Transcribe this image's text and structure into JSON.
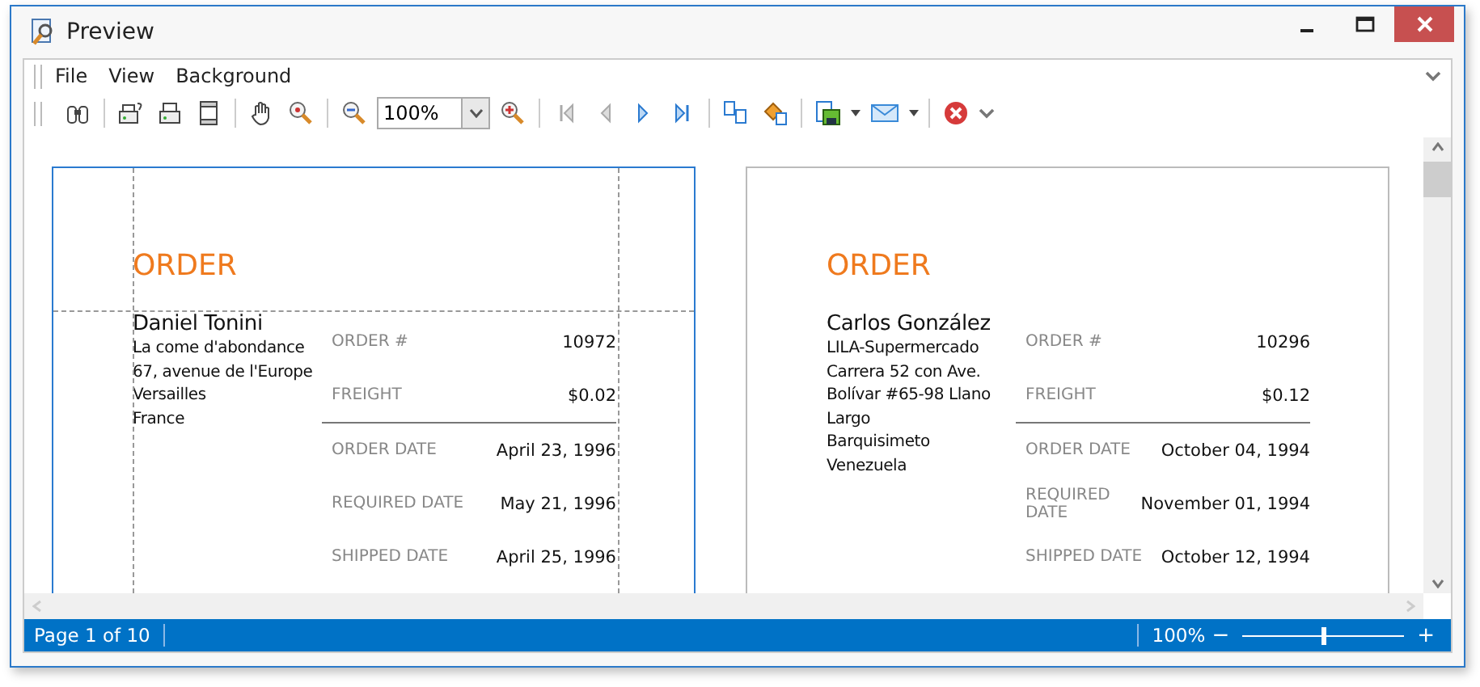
{
  "window": {
    "title": "Preview"
  },
  "menu": [
    {
      "label": "File"
    },
    {
      "label": "View"
    },
    {
      "label": "Background"
    }
  ],
  "toolbar": {
    "zoom_value": "100%"
  },
  "pages": [
    {
      "selected": true,
      "title": "ORDER",
      "customer": "Daniel Tonini",
      "address": [
        "La come d'abondance",
        "67, avenue de l'Europe",
        "Versailles",
        "France"
      ],
      "summary": [
        {
          "label": "ORDER #",
          "value": "10972"
        },
        {
          "label": "FREIGHT",
          "value": "$0.02"
        }
      ],
      "dates": [
        {
          "label": "ORDER DATE",
          "value": "April 23, 1996"
        },
        {
          "label": "REQUIRED DATE",
          "value": "May 21, 1996"
        },
        {
          "label": "SHIPPED DATE",
          "value": "April 25, 1996"
        }
      ]
    },
    {
      "selected": false,
      "title": "ORDER",
      "customer": "Carlos González",
      "address": [
        "LILA-Supermercado",
        "Carrera 52 con Ave. Bolívar #65-98 Llano Largo",
        "Barquisimeto",
        "Venezuela"
      ],
      "summary": [
        {
          "label": "ORDER #",
          "value": "10296"
        },
        {
          "label": "FREIGHT",
          "value": "$0.12"
        }
      ],
      "dates": [
        {
          "label": "ORDER DATE",
          "value": "October 04, 1994"
        },
        {
          "label": "REQUIRED DATE",
          "value": "November 01, 1994"
        },
        {
          "label": "SHIPPED DATE",
          "value": "October 12, 1994"
        }
      ]
    }
  ],
  "status_bar": {
    "page_info": "Page 1 of 10",
    "zoom": "100%",
    "zoom_out": "−",
    "zoom_in": "+",
    "level": 0.5
  }
}
